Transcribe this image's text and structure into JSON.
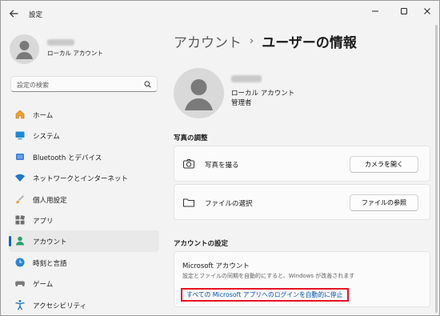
{
  "window": {
    "title": "設定",
    "controls": [
      "minimize",
      "maximize",
      "close"
    ]
  },
  "sidebar": {
    "user_type": "ローカル アカウント",
    "search_placeholder": "設定の検索",
    "items": [
      {
        "label": "ホーム",
        "icon": "home-icon"
      },
      {
        "label": "システム",
        "icon": "system-icon"
      },
      {
        "label": "Bluetooth とデバイス",
        "icon": "bluetooth-icon"
      },
      {
        "label": "ネットワークとインターネット",
        "icon": "wifi-icon"
      },
      {
        "label": "個人用設定",
        "icon": "paintbrush-icon"
      },
      {
        "label": "アプリ",
        "icon": "apps-icon"
      },
      {
        "label": "アカウント",
        "icon": "account-icon",
        "active": true
      },
      {
        "label": "時刻と言語",
        "icon": "clock-globe-icon"
      },
      {
        "label": "ゲーム",
        "icon": "gamepad-icon"
      },
      {
        "label": "アクセシビリティ",
        "icon": "accessibility-icon"
      }
    ]
  },
  "main": {
    "breadcrumb_parent": "アカウント",
    "breadcrumb_sep": "›",
    "breadcrumb_current": "ユーザーの情報",
    "profile": {
      "account_type": "ローカル アカウント",
      "role": "管理者"
    },
    "photo_section": {
      "title": "写真の調整",
      "rows": [
        {
          "label": "写真を撮る",
          "button": "カメラを開く",
          "icon": "camera-icon"
        },
        {
          "label": "ファイルの選択",
          "button": "ファイルの参照",
          "icon": "folder-icon"
        }
      ]
    },
    "account_settings": {
      "title": "アカウントの設定",
      "ms_title": "Microsoft アカウント",
      "ms_desc": "設定とファイルの同期を自動的にすると、Windows が改善されます",
      "ms_link": "すべての Microsoft アプリへのログインを自動的に停止"
    }
  },
  "colors": {
    "accent": "#0067c0",
    "highlight_border": "#e81123"
  }
}
